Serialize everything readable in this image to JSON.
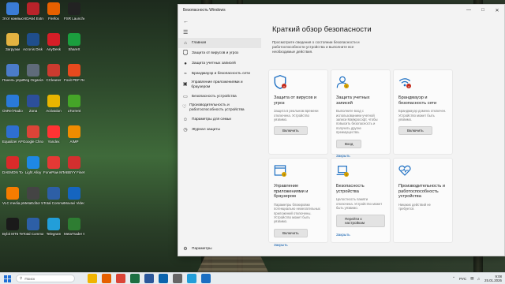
{
  "window": {
    "title": "Безопасность Windows"
  },
  "sidebar": {
    "items": [
      {
        "label": "Главная",
        "icon": "home-icon"
      },
      {
        "label": "Защита от вирусов и угроз",
        "icon": "shield-icon"
      },
      {
        "label": "Защита учетных записей",
        "icon": "person-icon"
      },
      {
        "label": "Брандмауэр и безопасность сети",
        "icon": "wifi-icon"
      },
      {
        "label": "Управление приложениями и браузером",
        "icon": "app-browser-icon"
      },
      {
        "label": "Безопасность устройства",
        "icon": "laptop-icon"
      },
      {
        "label": "Производительность и работоспособность устройства",
        "icon": "heart-icon"
      },
      {
        "label": "Параметры для семьи",
        "icon": "family-icon"
      },
      {
        "label": "Журнал защиты",
        "icon": "history-icon"
      }
    ],
    "settings_label": "Параметры"
  },
  "main": {
    "title": "Краткий обзор безопасности",
    "description": "Просмотрите сведения о состоянии безопасности и работоспособности устройства и выполните все необходимые действия."
  },
  "cards": [
    {
      "title": "Защита от вирусов и угроз",
      "desc": "Защита в реальном времени отключена. Устройство уязвимо.",
      "action": "Включить",
      "action_type": "button",
      "icon": "shield-icon",
      "status": "red"
    },
    {
      "title": "Защита учетных записей",
      "desc": "Выполните вход с использованием учетной записи Майкрософт, чтобы повысить безопасность и получить другие преимущества.",
      "action": "Вход",
      "action_type": "button",
      "extra_link": "Закрыть",
      "icon": "person-icon",
      "status": "yellow"
    },
    {
      "title": "Брандмауэр и безопасность сети",
      "desc": "Брандмауэр домена отключен. Устройство может быть уязвимо.",
      "action": "Включить",
      "action_type": "button",
      "icon": "wifi-icon",
      "status": "red"
    },
    {
      "title": "Управление приложениями и браузером",
      "desc": "Параметры блокировки потенциально нежелательных приложений отключены. Устройство может быть уязвимо.",
      "action": "Включить",
      "action_type": "button",
      "extra_link": "Закрыть",
      "icon": "app-browser-icon",
      "status": "yellow"
    },
    {
      "title": "Безопасность устройства",
      "desc": "Целостность памяти отключена. Устройство может быть уязвимо.",
      "action": "Перейти к настройкам",
      "action_type": "button",
      "extra_link": "Закрыть",
      "icon": "laptop-icon",
      "status": "yellow"
    },
    {
      "title": "Производительность и работоспособность устройства",
      "desc": "Никаких действий не требуется.",
      "action": "",
      "action_type": "none",
      "icon": "heart-icon",
      "status": "none"
    }
  ],
  "desktop_icons": [
    {
      "label": "Этот компьютер",
      "icon": "computer-icon",
      "color": "#3a7bd5"
    },
    {
      "label": "AIDA64 Extreme",
      "icon": "aida64-icon",
      "color": "#b8232a"
    },
    {
      "label": "Firefox",
      "icon": "firefox-icon",
      "color": "#e66000"
    },
    {
      "label": "FSR Launcher",
      "icon": "fsr-icon",
      "color": "#222222"
    },
    {
      "label": "Загрузки",
      "icon": "downloads-icon",
      "color": "#e3b341"
    },
    {
      "label": "Acronis Disk Director 12.5",
      "icon": "acronis-icon",
      "color": "#1f4e8c"
    },
    {
      "label": "AnyDesk",
      "icon": "anydesk-icon",
      "color": "#d51e27"
    },
    {
      "label": "ShareX",
      "icon": "sharex-icon",
      "color": "#1b9e3e"
    },
    {
      "label": "Панель управления",
      "icon": "control-panel-icon",
      "color": "#4b7cc9"
    },
    {
      "label": "Reg Organizer",
      "icon": "reg-organizer-icon",
      "color": "#5f6b7a"
    },
    {
      "label": "CCleaner",
      "icon": "ccleaner-icon",
      "color": "#cc3b2f"
    },
    {
      "label": "Foxit PDF Reader",
      "icon": "foxit-icon",
      "color": "#e84a1e"
    },
    {
      "label": "OnRel Radio.amp",
      "icon": "radio-icon",
      "color": "#2a7ad8"
    },
    {
      "label": "Zona",
      "icon": "zona-icon",
      "color": "#2c4f9a"
    },
    {
      "label": "Activation",
      "icon": "activation-icon",
      "color": "#e8b500"
    },
    {
      "label": "uTorrent",
      "icon": "utorrent-icon",
      "color": "#45a528"
    },
    {
      "label": "Equalizer APO Config",
      "icon": "equalizer-icon",
      "color": "#2e6fd0"
    },
    {
      "label": "Google Chrome",
      "icon": "chrome-icon",
      "color": "#db4437"
    },
    {
      "label": "Yandex",
      "icon": "yandex-icon",
      "color": "#ff3333"
    },
    {
      "label": "AIMP",
      "icon": "aimp-icon",
      "color": "#f08c00"
    },
    {
      "label": "DAEMON Tools Ultra",
      "icon": "daemon-tools-icon",
      "color": "#d92a2a"
    },
    {
      "label": "Light Alloy",
      "icon": "light-alloy-icon",
      "color": "#1e88e5"
    },
    {
      "label": "FonePaw MTS",
      "icon": "fonepaw-icon",
      "color": "#e53935"
    },
    {
      "label": "ABBYY FineReader",
      "icon": "abbyy-icon",
      "color": "#d32f2f"
    },
    {
      "label": "VLC media player",
      "icon": "vlc-icon",
      "color": "#f57c00"
    },
    {
      "label": "MetaEditor 5",
      "icon": "metaeditor-icon",
      "color": "#444444"
    },
    {
      "label": "Total Commander",
      "icon": "total-commander-icon",
      "color": "#2d5fa6"
    },
    {
      "label": "Movavi Video Editor",
      "icon": "movavi-icon",
      "color": "#1565c0"
    },
    {
      "label": "Bybit MT5 Terminal",
      "icon": "bybit-icon",
      "color": "#1a1a1a"
    },
    {
      "label": "Total Commander",
      "icon": "total-commander-icon",
      "color": "#2d5fa6"
    },
    {
      "label": "Telegram",
      "icon": "telegram-icon",
      "color": "#229ed9"
    },
    {
      "label": "MetaTrader 5_demo",
      "icon": "metatrader-icon",
      "color": "#2e7d32"
    }
  ],
  "taskbar": {
    "search_placeholder": "Поиск",
    "language": "РУС",
    "time": "9:08",
    "date": "25.01.2026",
    "pinned": [
      {
        "icon": "file-explorer-icon",
        "color": "#f0b400"
      },
      {
        "icon": "firefox-icon",
        "color": "#e66000"
      },
      {
        "icon": "chrome-icon",
        "color": "#db4437"
      },
      {
        "icon": "excel-icon",
        "color": "#1d6f42"
      },
      {
        "icon": "word-icon",
        "color": "#2b579a"
      },
      {
        "icon": "outlook-icon",
        "color": "#0a64ad"
      },
      {
        "icon": "camera-icon",
        "color": "#666666"
      },
      {
        "icon": "telegram-icon",
        "color": "#229ed9"
      },
      {
        "icon": "windows-security-icon",
        "color": "#1b6ec2"
      }
    ]
  }
}
